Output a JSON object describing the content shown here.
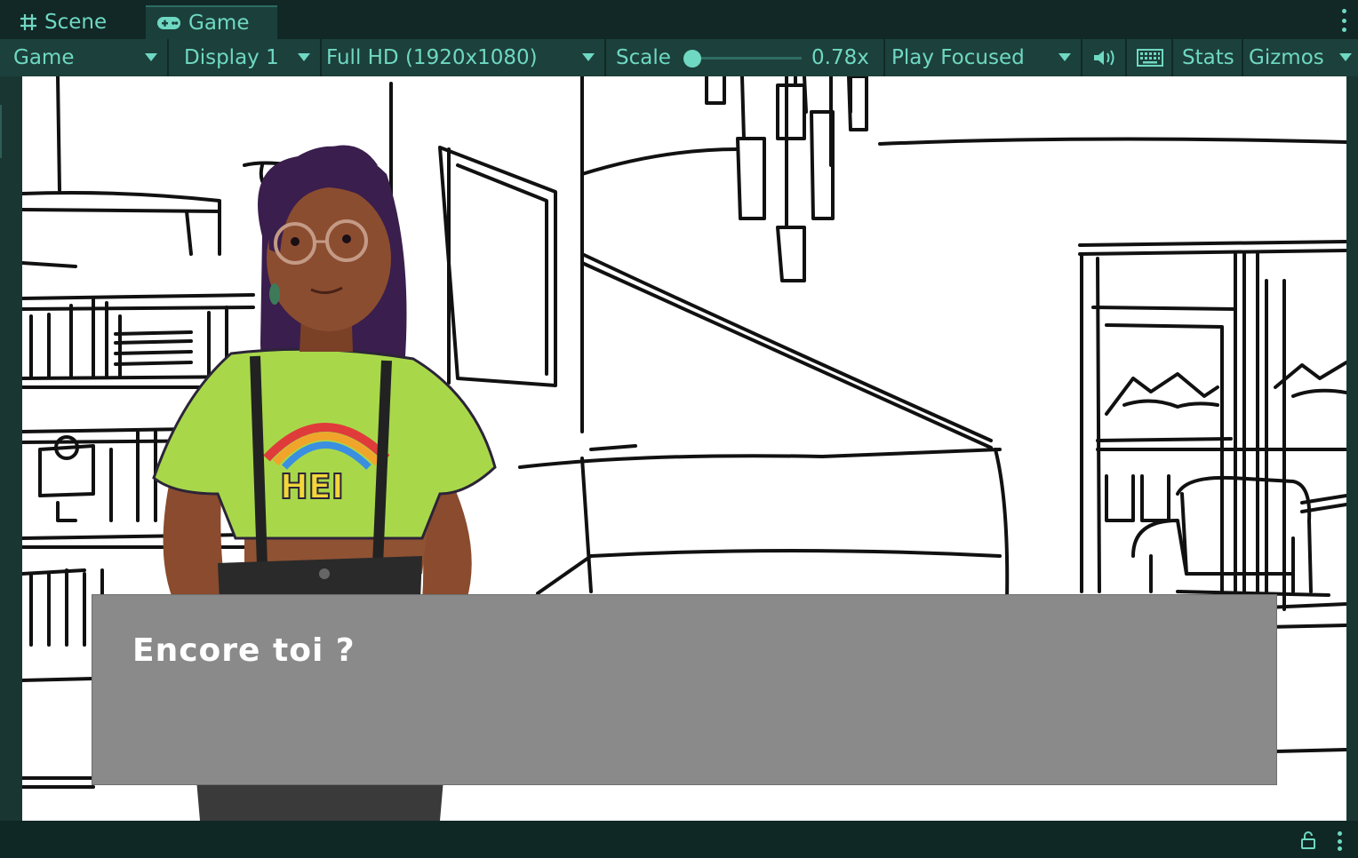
{
  "tabs": [
    {
      "label": "Scene",
      "icon": "grid-icon"
    },
    {
      "label": "Game",
      "icon": "gamepad-icon",
      "active": true
    }
  ],
  "toolbar": {
    "view_select": "Game",
    "display_select": "Display 1",
    "resolution_select": "Full HD (1920x1080)",
    "scale_label": "Scale",
    "scale_value": "0.78x",
    "scale_fraction": 0.0,
    "play_mode": "Play Focused",
    "stats_label": "Stats",
    "gizmos_label": "Gizmos"
  },
  "game": {
    "dialog_text": "Encore toi ?"
  },
  "colors": {
    "editor_bg": "#15302d",
    "accent": "#6fd8c2",
    "dialog_bg": "#8a8a8a",
    "dialog_text": "#ffffff"
  }
}
